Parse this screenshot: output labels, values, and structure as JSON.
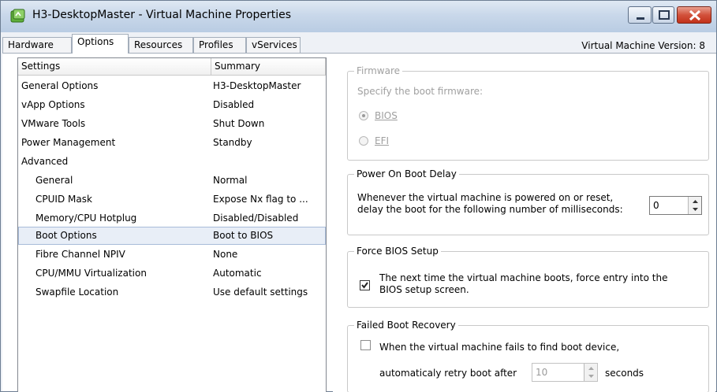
{
  "window": {
    "title": "H3-DesktopMaster - Virtual Machine Properties",
    "icons": {
      "app": "vm-icon",
      "minimize": "minimize-icon",
      "maximize": "maximize-icon",
      "close": "close-icon"
    }
  },
  "tabs": [
    {
      "label": "Hardware",
      "active": false
    },
    {
      "label": "Options",
      "active": true
    },
    {
      "label": "Resources",
      "active": false
    },
    {
      "label": "Profiles",
      "active": false
    },
    {
      "label": "vServices",
      "active": false
    }
  ],
  "vm_version": "Virtual Machine Version: 8",
  "settings": {
    "columns": [
      "Settings",
      "Summary"
    ],
    "rows": [
      {
        "setting": "General Options",
        "summary": "H3-DesktopMaster"
      },
      {
        "setting": "vApp Options",
        "summary": "Disabled"
      },
      {
        "setting": "VMware Tools",
        "summary": "Shut Down"
      },
      {
        "setting": "Power Management",
        "summary": "Standby"
      },
      {
        "setting": "Advanced",
        "summary": ""
      },
      {
        "setting": "General",
        "summary": "Normal"
      },
      {
        "setting": "CPUID Mask",
        "summary": "Expose Nx flag to ..."
      },
      {
        "setting": "Memory/CPU Hotplug",
        "summary": "Disabled/Disabled"
      },
      {
        "setting": "Boot Options",
        "summary": "Boot to BIOS",
        "selected": true
      },
      {
        "setting": "Fibre Channel NPIV",
        "summary": "None"
      },
      {
        "setting": "CPU/MMU Virtualization",
        "summary": "Automatic"
      },
      {
        "setting": "Swapfile Location",
        "summary": "Use default settings"
      }
    ]
  },
  "firmware": {
    "legend": "Firmware",
    "prompt": "Specify the boot firmware:",
    "bios_label": "BIOS",
    "efi_label": "EFI",
    "selected": "BIOS",
    "enabled": false
  },
  "power_on_boot_delay": {
    "legend": "Power On Boot Delay",
    "line1": "Whenever the virtual machine is powered on or reset,",
    "line2": "delay the boot for the following number of milliseconds:",
    "value": "0"
  },
  "force_bios_setup": {
    "legend": "Force BIOS Setup",
    "line1": "The next time the virtual machine boots, force entry into the",
    "line2": "BIOS setup screen.",
    "checked": true
  },
  "failed_boot_recovery": {
    "legend": "Failed Boot Recovery",
    "line1": "When the virtual machine fails to find boot device,",
    "line2_prefix": "automaticaly retry boot after",
    "retry_value": "10",
    "line2_suffix": "seconds",
    "checked": false
  }
}
